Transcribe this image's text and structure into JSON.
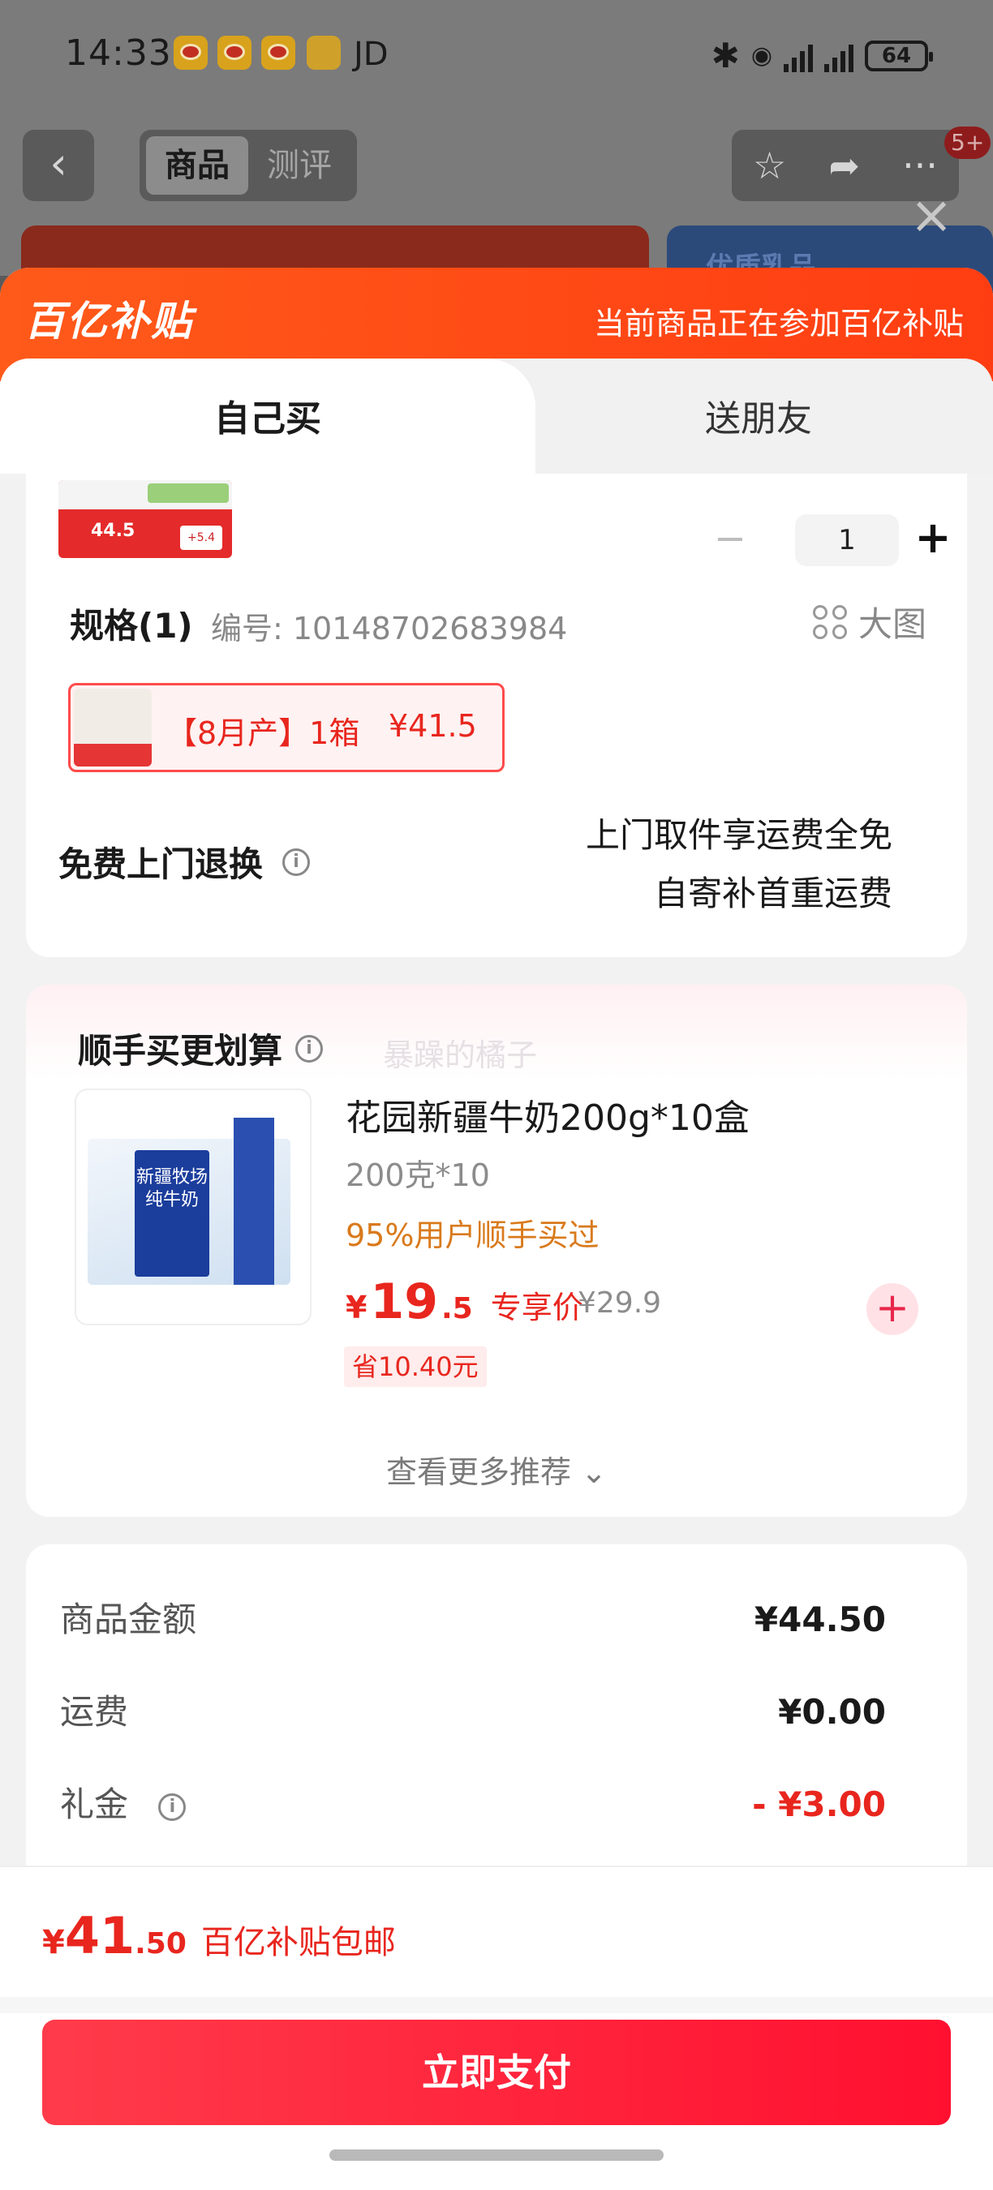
{
  "status_bar": {
    "time": "14:33",
    "carrier_label": "JD",
    "battery": "64"
  },
  "nav": {
    "tabs": [
      "商品",
      "测评"
    ],
    "active_tab": 0,
    "badge": "5+"
  },
  "background_card": {
    "label": "优质乳品"
  },
  "sheet": {
    "banner_logo": "百亿补贴",
    "banner_note": "当前商品正在参加百亿补贴",
    "tab_self": "自己买",
    "tab_friend": "送朋友"
  },
  "product": {
    "thumb_price": "44.5",
    "thumb_tag": "+5.4",
    "quantity": "1",
    "spec_title": "规格(1)",
    "spec_code": "编号: 10148702683984",
    "big_pic_label": "大图",
    "spec_option": "【8月产】1箱",
    "spec_option_price": "¥41.5"
  },
  "returns": {
    "title": "免费上门退换",
    "line1": "上门取件享运费全免",
    "line2": "自寄补首重运费"
  },
  "recommend": {
    "title": "顺手买更划算",
    "watermark": "暴躁的橘子",
    "item": {
      "name": "花园新疆牛奶200g*10盒",
      "spec": "200克*10",
      "social": "95%用户顺手买过",
      "price_symbol": "¥",
      "price_int": "19",
      "price_dec": ".5",
      "price_label": "专享价",
      "original_price": "¥29.9",
      "save": "省10.40元",
      "image_text": "新疆牧场纯牛奶"
    },
    "more": "查看更多推荐"
  },
  "summary": {
    "rows": [
      {
        "label": "商品金额",
        "value": "¥44.50"
      },
      {
        "label": "运费",
        "value": "¥0.00"
      },
      {
        "label": "礼金",
        "value": "- ¥3.00"
      }
    ]
  },
  "pay": {
    "symbol": "¥",
    "total_int": "41",
    "total_dec": ".50",
    "note": "百亿补贴包邮",
    "button": "立即支付"
  },
  "colors": {
    "accent": "#e8261e",
    "banner": "#ff4a16",
    "pay_button": "#ff1f3d",
    "social": "#d97a1c"
  }
}
